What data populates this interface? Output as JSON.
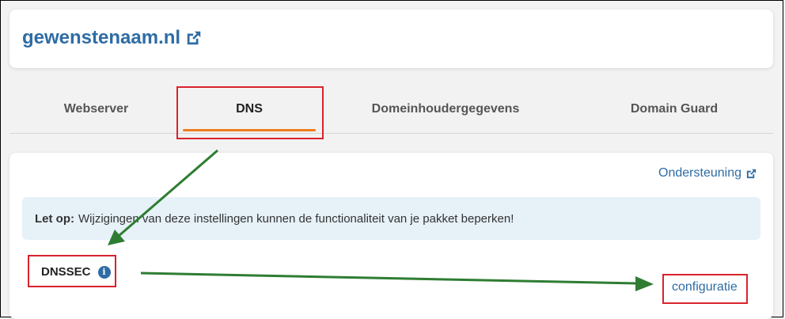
{
  "header": {
    "domain": "gewenstenaam.nl"
  },
  "tabs": [
    {
      "label": "Webserver"
    },
    {
      "label": "DNS"
    },
    {
      "label": "Domeinhoudergegevens"
    },
    {
      "label": "Domain Guard"
    }
  ],
  "active_tab": "DNS",
  "content": {
    "support_link": "Ondersteuning",
    "alert_bold": "Let op:",
    "alert_text": "Wijzigingen van deze instellingen kunnen de functionaliteit van je pakket beperken!",
    "dnssec_label": "DNSSEC",
    "config_link": "configuratie"
  },
  "colors": {
    "link": "#2e6ca4",
    "tab_underline": "#f07d1e",
    "alert_bg": "#e6f1f8",
    "annotation_red": "#d9232d",
    "annotation_arrow": "#2e7d32"
  }
}
